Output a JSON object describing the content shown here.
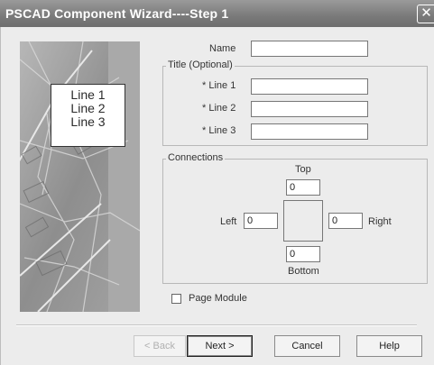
{
  "window": {
    "title": "PSCAD Component Wizard----Step 1",
    "close_glyph": "✕"
  },
  "banner": {
    "preview_lines": [
      "Line 1",
      "Line 2",
      "Line 3"
    ]
  },
  "form": {
    "name_label": "Name",
    "name_value": "",
    "title_group_label": "Title (Optional)",
    "line1_label": "* Line 1",
    "line2_label": "* Line 2",
    "line3_label": "* Line 3",
    "line1_value": "",
    "line2_value": "",
    "line3_value": ""
  },
  "connections": {
    "group_label": "Connections",
    "top_label": "Top",
    "top_value": "0",
    "left_label": "Left",
    "left_value": "0",
    "right_label": "Right",
    "right_value": "0",
    "bottom_label": "Bottom",
    "bottom_value": "0"
  },
  "page_module": {
    "label": "Page Module",
    "checked": false
  },
  "buttons": {
    "back": "< Back",
    "next": "Next >",
    "cancel": "Cancel",
    "help": "Help"
  }
}
